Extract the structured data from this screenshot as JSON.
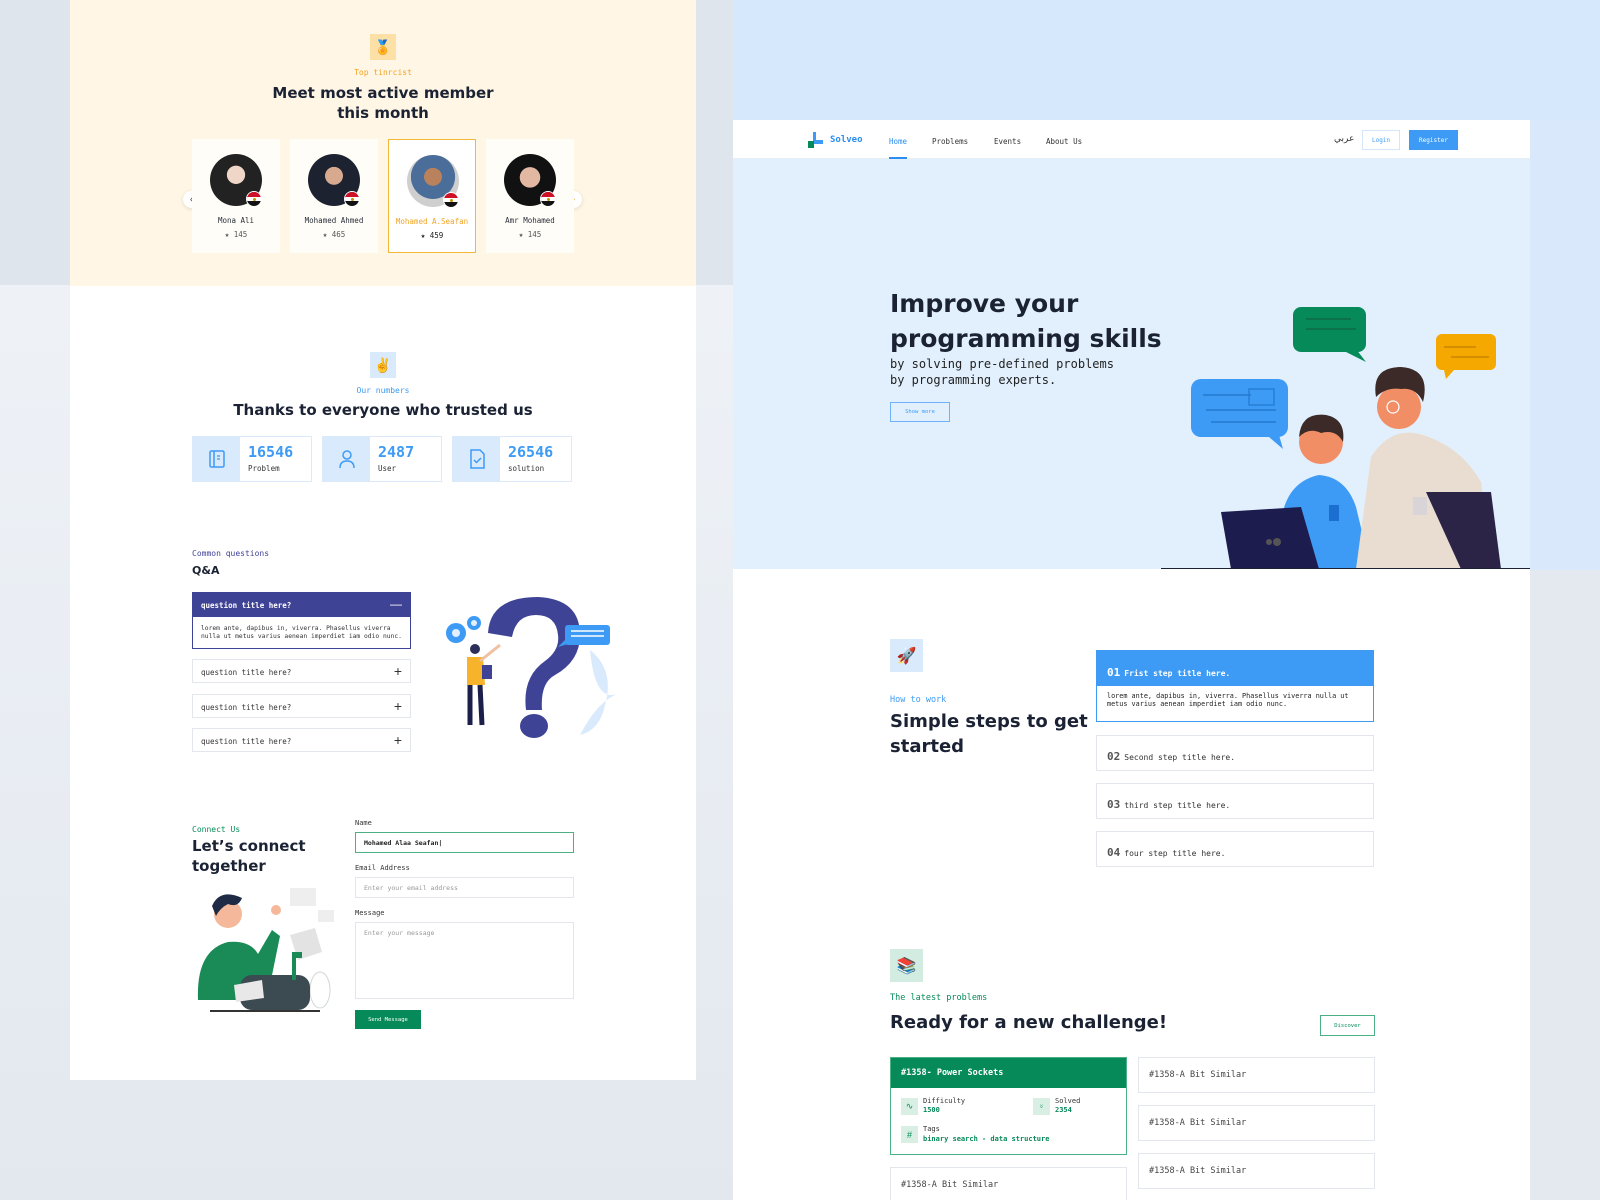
{
  "members_section": {
    "icon": "medal-icon",
    "kicker": "Top tinrcist",
    "title_line1": "Meet most active member",
    "title_line2": "this month",
    "prev_icon": "‹",
    "next_icon": "›",
    "members": [
      {
        "name": "Mona Ali",
        "score": "145",
        "active": false
      },
      {
        "name": "Mohamed Ahmed",
        "score": "465",
        "active": false
      },
      {
        "name": "Mohamed A.Seafan",
        "score": "459",
        "active": true
      },
      {
        "name": "Amr Mohamed",
        "score": "145",
        "active": false
      }
    ]
  },
  "numbers_section": {
    "icon": "victory-hand-icon",
    "kicker": "Our numbers",
    "title": "Thanks to everyone who trusted us",
    "stats": [
      {
        "value": "16546",
        "label": "Problem",
        "icon": "book-icon"
      },
      {
        "value": "2487",
        "label": "User",
        "icon": "user-icon"
      },
      {
        "value": "26546",
        "label": "solution",
        "icon": "file-check-icon"
      }
    ]
  },
  "qa_section": {
    "kicker": "Common questions",
    "title": "Q&A",
    "open_item": {
      "question": "question title here?",
      "answer": "lorem ante, dapibus in, viverra. Phasellus viverra nulla ut metus varius aenean imperdiet iam odio nunc.",
      "toggle": "—"
    },
    "items": [
      {
        "question": "question title here?",
        "toggle": "+"
      },
      {
        "question": "question title here?",
        "toggle": "+"
      },
      {
        "question": "question title here?",
        "toggle": "+"
      }
    ]
  },
  "contact_section": {
    "kicker": "Connect Us",
    "title_line1": "Let’s connect",
    "title_line2": "together",
    "name_label": "Name",
    "name_value": "Mohamed Alaa Seafan|",
    "email_label": "Email Address",
    "email_placeholder": "Enter your email address",
    "message_label": "Message",
    "message_placeholder": "Enter your message",
    "send_label": "Send Message"
  },
  "navbar": {
    "brand": "Solveo",
    "links": [
      "Home",
      "Problems",
      "Events",
      "About Us"
    ],
    "active_link": "Home",
    "language": "عربي",
    "login": "Login",
    "register": "Register"
  },
  "hero": {
    "title_line1": "Improve your",
    "title_line2": "programming skills",
    "subtitle_line1": "by solving pre-defined problems",
    "subtitle_line2": "by programming experts.",
    "cta": "Show more"
  },
  "steps_section": {
    "icon": "rocket-icon",
    "kicker": "How to work",
    "title_line1": "Simple steps to get",
    "title_line2": "started",
    "open_step": {
      "num": "01",
      "title": "Frist step title here.",
      "body": "lorem ante, dapibus in, viverra. Phasellus viverra nulla ut metus varius aenean imperdiet iam odio nunc."
    },
    "steps": [
      {
        "num": "02",
        "title": "Second step title here."
      },
      {
        "num": "03",
        "title": "third step title here."
      },
      {
        "num": "04",
        "title": "four step title here."
      }
    ]
  },
  "problems_section": {
    "icon": "books-icon",
    "kicker": "The latest problems",
    "title": "Ready for a new challenge!",
    "discover": "Discover",
    "featured": {
      "title": "#1358- Power Sockets",
      "difficulty_label": "Difficulty",
      "difficulty_value": "1500",
      "solved_label": "Solved",
      "solved_value": "2354",
      "tags_label": "Tags",
      "tags_value": "binary search - data structure"
    },
    "cards": [
      "#1358-A Bit Similar",
      "#1358-A Bit Similar",
      "#1358-A Bit Similar",
      "#1358-A Bit Similar"
    ]
  },
  "colors": {
    "accent_blue": "#3d9bf5",
    "accent_green": "#078a5a",
    "accent_orange": "#f0a526",
    "accent_indigo": "#3f4395"
  }
}
